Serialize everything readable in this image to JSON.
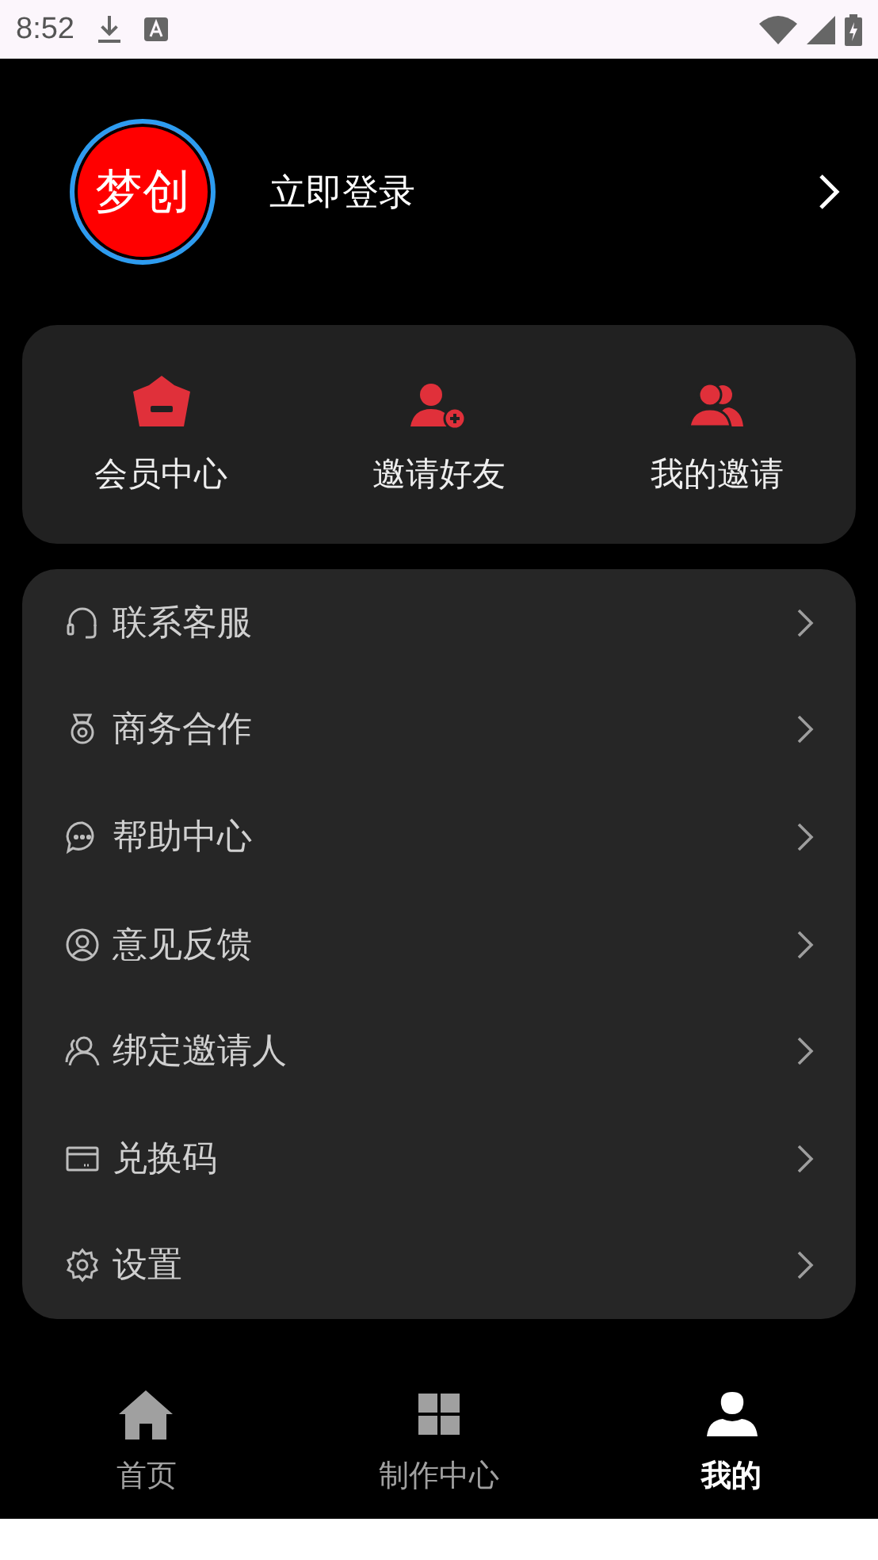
{
  "status_bar": {
    "time": "8:52"
  },
  "profile": {
    "logo_text": "梦创",
    "login": "立即登录"
  },
  "quick_actions": [
    {
      "kind": "crown",
      "label": "会员中心"
    },
    {
      "kind": "add-user",
      "label": "邀请好友"
    },
    {
      "kind": "users",
      "label": "我的邀请"
    }
  ],
  "menu": [
    {
      "kind": "headset",
      "label": "联系客服"
    },
    {
      "kind": "medal",
      "label": "商务合作"
    },
    {
      "kind": "chat",
      "label": "帮助中心"
    },
    {
      "kind": "user-circle",
      "label": "意见反馈"
    },
    {
      "kind": "user",
      "label": "绑定邀请人"
    },
    {
      "kind": "card",
      "label": "兑换码"
    },
    {
      "kind": "gear",
      "label": "设置"
    }
  ],
  "tabs": [
    {
      "kind": "home",
      "label": "首页",
      "selected": false
    },
    {
      "kind": "grid",
      "label": "制作中心",
      "selected": false
    },
    {
      "kind": "person",
      "label": "我的",
      "selected": true
    }
  ]
}
